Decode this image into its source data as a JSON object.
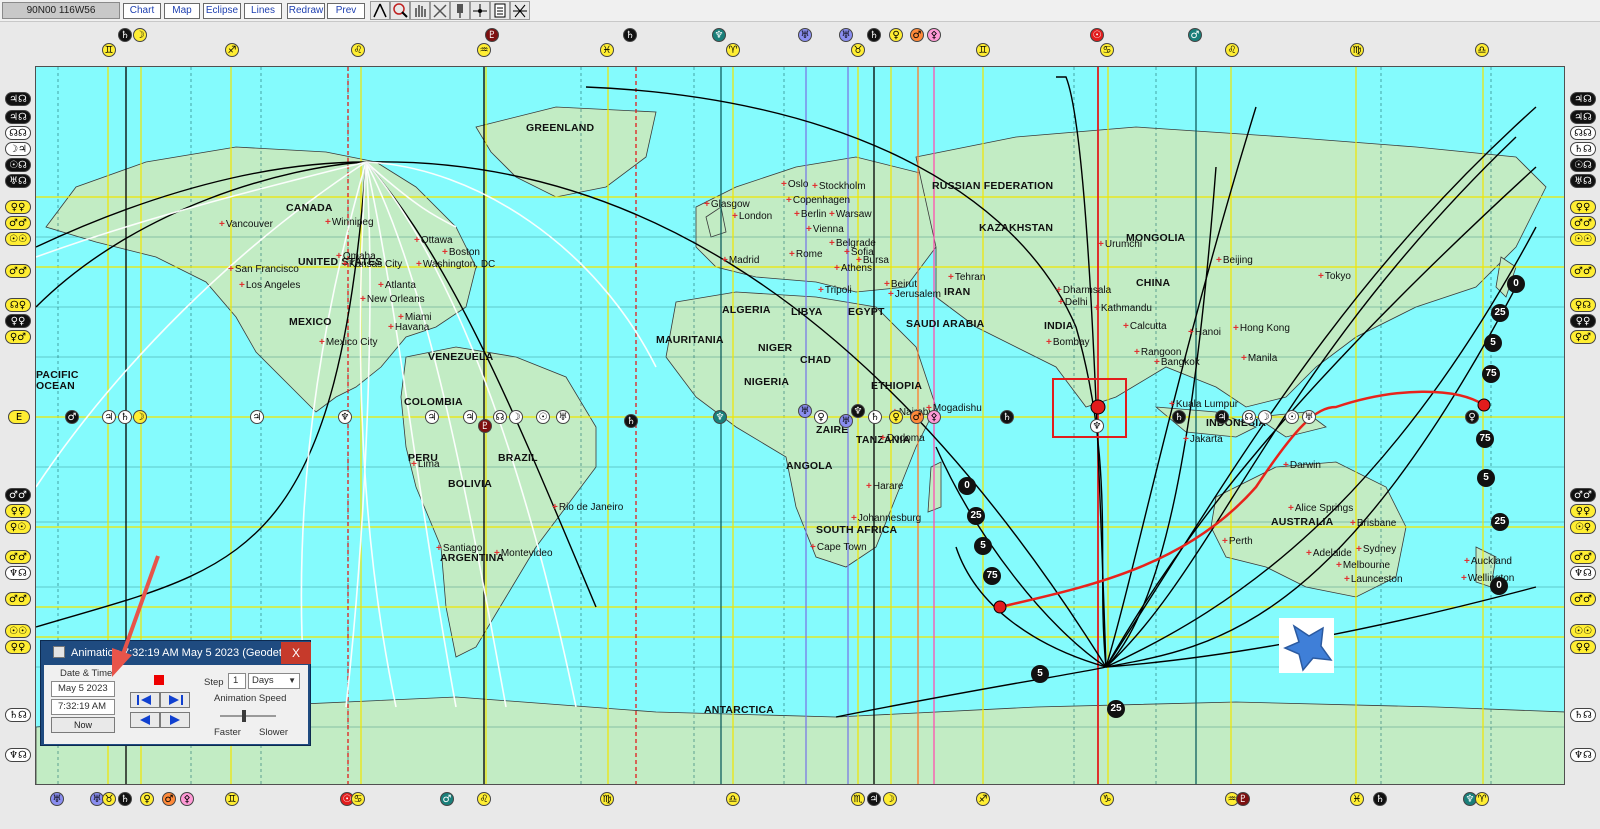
{
  "toolbar": {
    "coords": "90N00  116W56",
    "buttons": [
      "Chart",
      "Map",
      "Eclipse",
      "Lines",
      "Redraw",
      "Prev"
    ]
  },
  "map": {
    "countries": [
      "GREENLAND",
      "CANADA",
      "UNITED STATES",
      "MEXICO",
      "COLOMBIA",
      "VENEZUELA",
      "PERU",
      "BRAZIL",
      "BOLIVIA",
      "ARGENTINA",
      "ALGERIA",
      "MAURITANIA",
      "LIBYA",
      "EGYPT",
      "NIGER",
      "CHAD",
      "NIGERIA",
      "ETHIOPIA",
      "ZAIRE",
      "TANZANIA",
      "ANGOLA",
      "SOUTH AFRICA",
      "SAUDI ARABIA",
      "IRAN",
      "RUSSIAN FEDERATION",
      "KAZAKHSTAN",
      "MONGOLIA",
      "CHINA",
      "INDIA",
      "AUSTRALIA",
      "ANTARCTICA",
      "PACIFIC OCEAN",
      "INDONESIA"
    ],
    "cities": [
      "Vancouver",
      "Winnipeg",
      "Ottawa",
      "Boston",
      "Omaha",
      "Kansas City",
      "Washington, DC",
      "San Francisco",
      "Los Angeles",
      "Atlanta",
      "New Orleans",
      "Miami",
      "Havana",
      "Mexico City",
      "Lima",
      "Rio de Janeiro",
      "Santiago",
      "Montevideo",
      "Glasgow",
      "London",
      "Oslo",
      "Stockholm",
      "Copenhagen",
      "Berlin",
      "Warsaw",
      "Vienna",
      "Rome",
      "Belgrade",
      "Sofia",
      "Madrid",
      "Tripoli",
      "Athens",
      "Bursa",
      "Beirut",
      "Jerusalem",
      "Tehran",
      "Nairobi",
      "Mogadishu",
      "Harare",
      "Johannesburg",
      "Cape Town",
      "Dharmsala",
      "Delhi",
      "Kathmandu",
      "Calcutta",
      "Bombay",
      "Urumchi",
      "Beijing",
      "Tokyo",
      "Hanoi",
      "Hong Kong",
      "Rangoon",
      "Bangkok",
      "Manila",
      "Kuala Lumpur",
      "Jakarta",
      "Darwin",
      "Alice Springs",
      "Brisbane",
      "Perth",
      "Adelaide",
      "Sydney",
      "Melbourne",
      "Launceston",
      "Auckland",
      "Wellington",
      "Dodoma"
    ]
  },
  "ages": [
    "0",
    "25",
    "5",
    "75",
    "0",
    "25",
    "5",
    "75",
    "0",
    "25",
    "5",
    "75",
    "5",
    "25"
  ],
  "animation": {
    "title": "Animation 7:32:19 AM May 5 2023 (Geodetic)",
    "close": "X",
    "date_time_label": "Date & Time",
    "date": "May 5 2023",
    "time": "7:32:19 AM",
    "now": "Now",
    "step_label": "Step",
    "step_value": "1",
    "step_unit": "Days",
    "speed_label": "Animation Speed",
    "faster": "Faster",
    "slower": "Slower"
  },
  "colors": {
    "ocean": "#84fbfd",
    "land": "#c2ecc4",
    "progressed_path": "#e8231b",
    "dialog_title": "#1f4b80"
  },
  "icons": [
    "stop-icon",
    "step-back-icon",
    "step-forward-icon",
    "play-back-icon",
    "play-forward-icon",
    "star-icon",
    "zoom-icon",
    "hand-icon",
    "crosshair-icon"
  ]
}
